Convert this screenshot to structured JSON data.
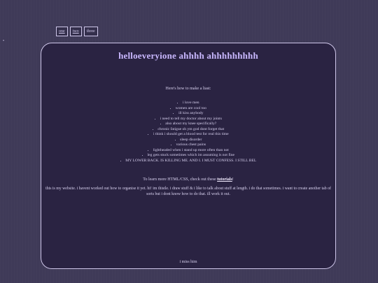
{
  "nav": {
    "links": [
      "one",
      "two",
      "three"
    ]
  },
  "page": {
    "title": "helloeveryione ahhhh ahhhhhhhhh",
    "intro": "Here's how to make a liast:",
    "list": [
      "i love men",
      "women are cool too",
      "ill kiss anybody",
      "i need to tell my doctor about my joints",
      "also about my knee specifically?",
      "chronic fatigue oh ym god dont forget that",
      "i think i should get a blood test for real this time",
      "sleep disorder",
      "various chest pains",
      "lightheaded when i stand up more often than not",
      "leg gets stuck sometimes which im assuming is not fine",
      "MY LOWER BACK. IS KILLING ME. AND I. I MUST CONFESS. I STILL BEL"
    ],
    "learn_prefix": "To learn more HTML/CSS, check out these ",
    "learn_link": "tutorials",
    "learn_suffix": "!",
    "about": "this is my website. i havent worked out how to organise it yet. hi! im thistle. i draw stuff & i like to talk about stuff at length. i do that sometimes. i want to create another tab of sorts but i dont know how to do that. ill work it out.",
    "footer": "i miss him"
  }
}
